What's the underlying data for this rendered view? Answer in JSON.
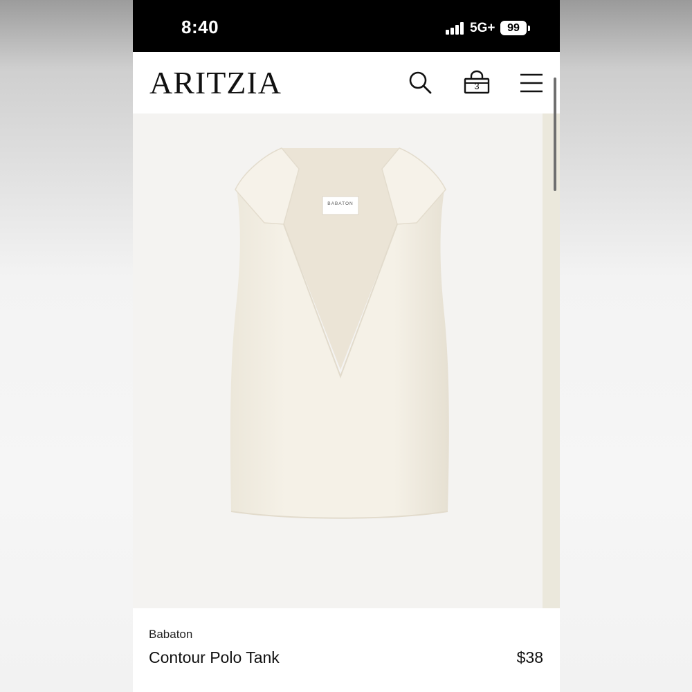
{
  "status_bar": {
    "time": "8:40",
    "network": "5G+",
    "battery": "99"
  },
  "header": {
    "logo": "ARITZIA",
    "bag_count": "3",
    "icons": [
      "search-icon",
      "shopping-bag-icon",
      "hamburger-menu-icon"
    ]
  },
  "product": {
    "image_label_text": "BABATON",
    "brand": "Babaton",
    "name": "Contour Polo Tank",
    "price": "$38"
  },
  "colors": {
    "status_bar_bg": "#000000",
    "page_bg": "#ffffff",
    "image_bg": "#f4f3f1",
    "garment": "#f1ede2"
  }
}
